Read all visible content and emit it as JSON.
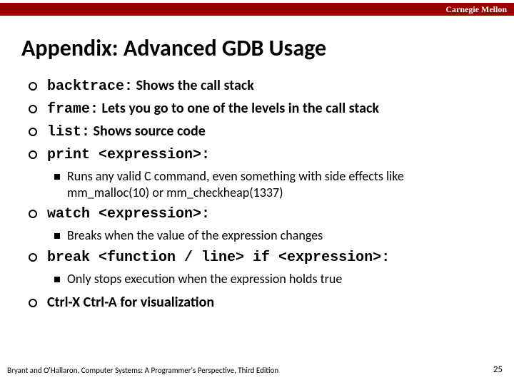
{
  "brand": "Carnegie Mellon",
  "title": "Appendix: Advanced GDB Usage",
  "items": [
    {
      "cmd": "backtrace:",
      "desc": " Shows the call stack"
    },
    {
      "cmd": "frame:",
      "desc": " Lets you go to one of the levels in the call stack"
    },
    {
      "cmd": "list:",
      "desc": " Shows source code"
    },
    {
      "cmd": "print <expression>:",
      "desc": "",
      "sub": [
        "Runs any valid C command, even something with side effects like mm_malloc(10) or mm_checkheap(1337)"
      ]
    },
    {
      "cmd": "watch <expression>:",
      "desc": "",
      "sub": [
        "Breaks when the value of the expression changes"
      ]
    },
    {
      "cmd": "break <function / line> if <expression>:",
      "desc": "",
      "sub": [
        "Only stops execution when the expression holds true"
      ]
    },
    {
      "plain": "Ctrl-X Ctrl-A for visualization"
    }
  ],
  "footer": "Bryant and O'Hallaron, Computer Systems: A Programmer's Perspective, Third Edition",
  "page": "25"
}
